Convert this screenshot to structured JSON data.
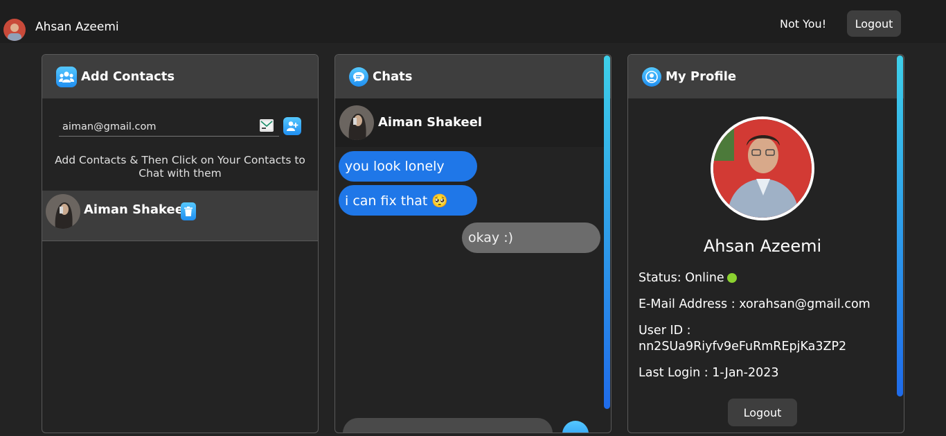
{
  "header": {
    "user_name": "Ahsan Azeemi",
    "not_you_label": "Not You!",
    "logout_label": "Logout"
  },
  "add_contacts": {
    "title": "Add Contacts",
    "email_value": "aiman@gmail.com",
    "hint": "Add Contacts & Then Click on Your Contacts to Chat with them",
    "contacts": [
      {
        "name": "Aiman Shakeel"
      }
    ]
  },
  "chats": {
    "title": "Chats",
    "active_contact": "Aiman Shakeel",
    "messages": [
      {
        "text": "you look lonely",
        "direction": "in"
      },
      {
        "text": "i can fix that 🥺",
        "direction": "in"
      },
      {
        "text": "okay :)",
        "direction": "out"
      }
    ]
  },
  "profile": {
    "title": "My Profile",
    "name": "Ahsan Azeemi",
    "status_label": "Status: Online",
    "email_line": "E-Mail Address : xorahsan@gmail.com",
    "user_id_label": "User ID :",
    "user_id": "nn2SUa9Riyfv9eFuRmREpjKa3ZP2",
    "last_login_line": "Last Login : 1-Jan-2023",
    "logout_label": "Logout"
  },
  "colors": {
    "accent_blue": "#1f77e8",
    "online": "#8bd130",
    "panel_head": "#3e3e3e"
  }
}
